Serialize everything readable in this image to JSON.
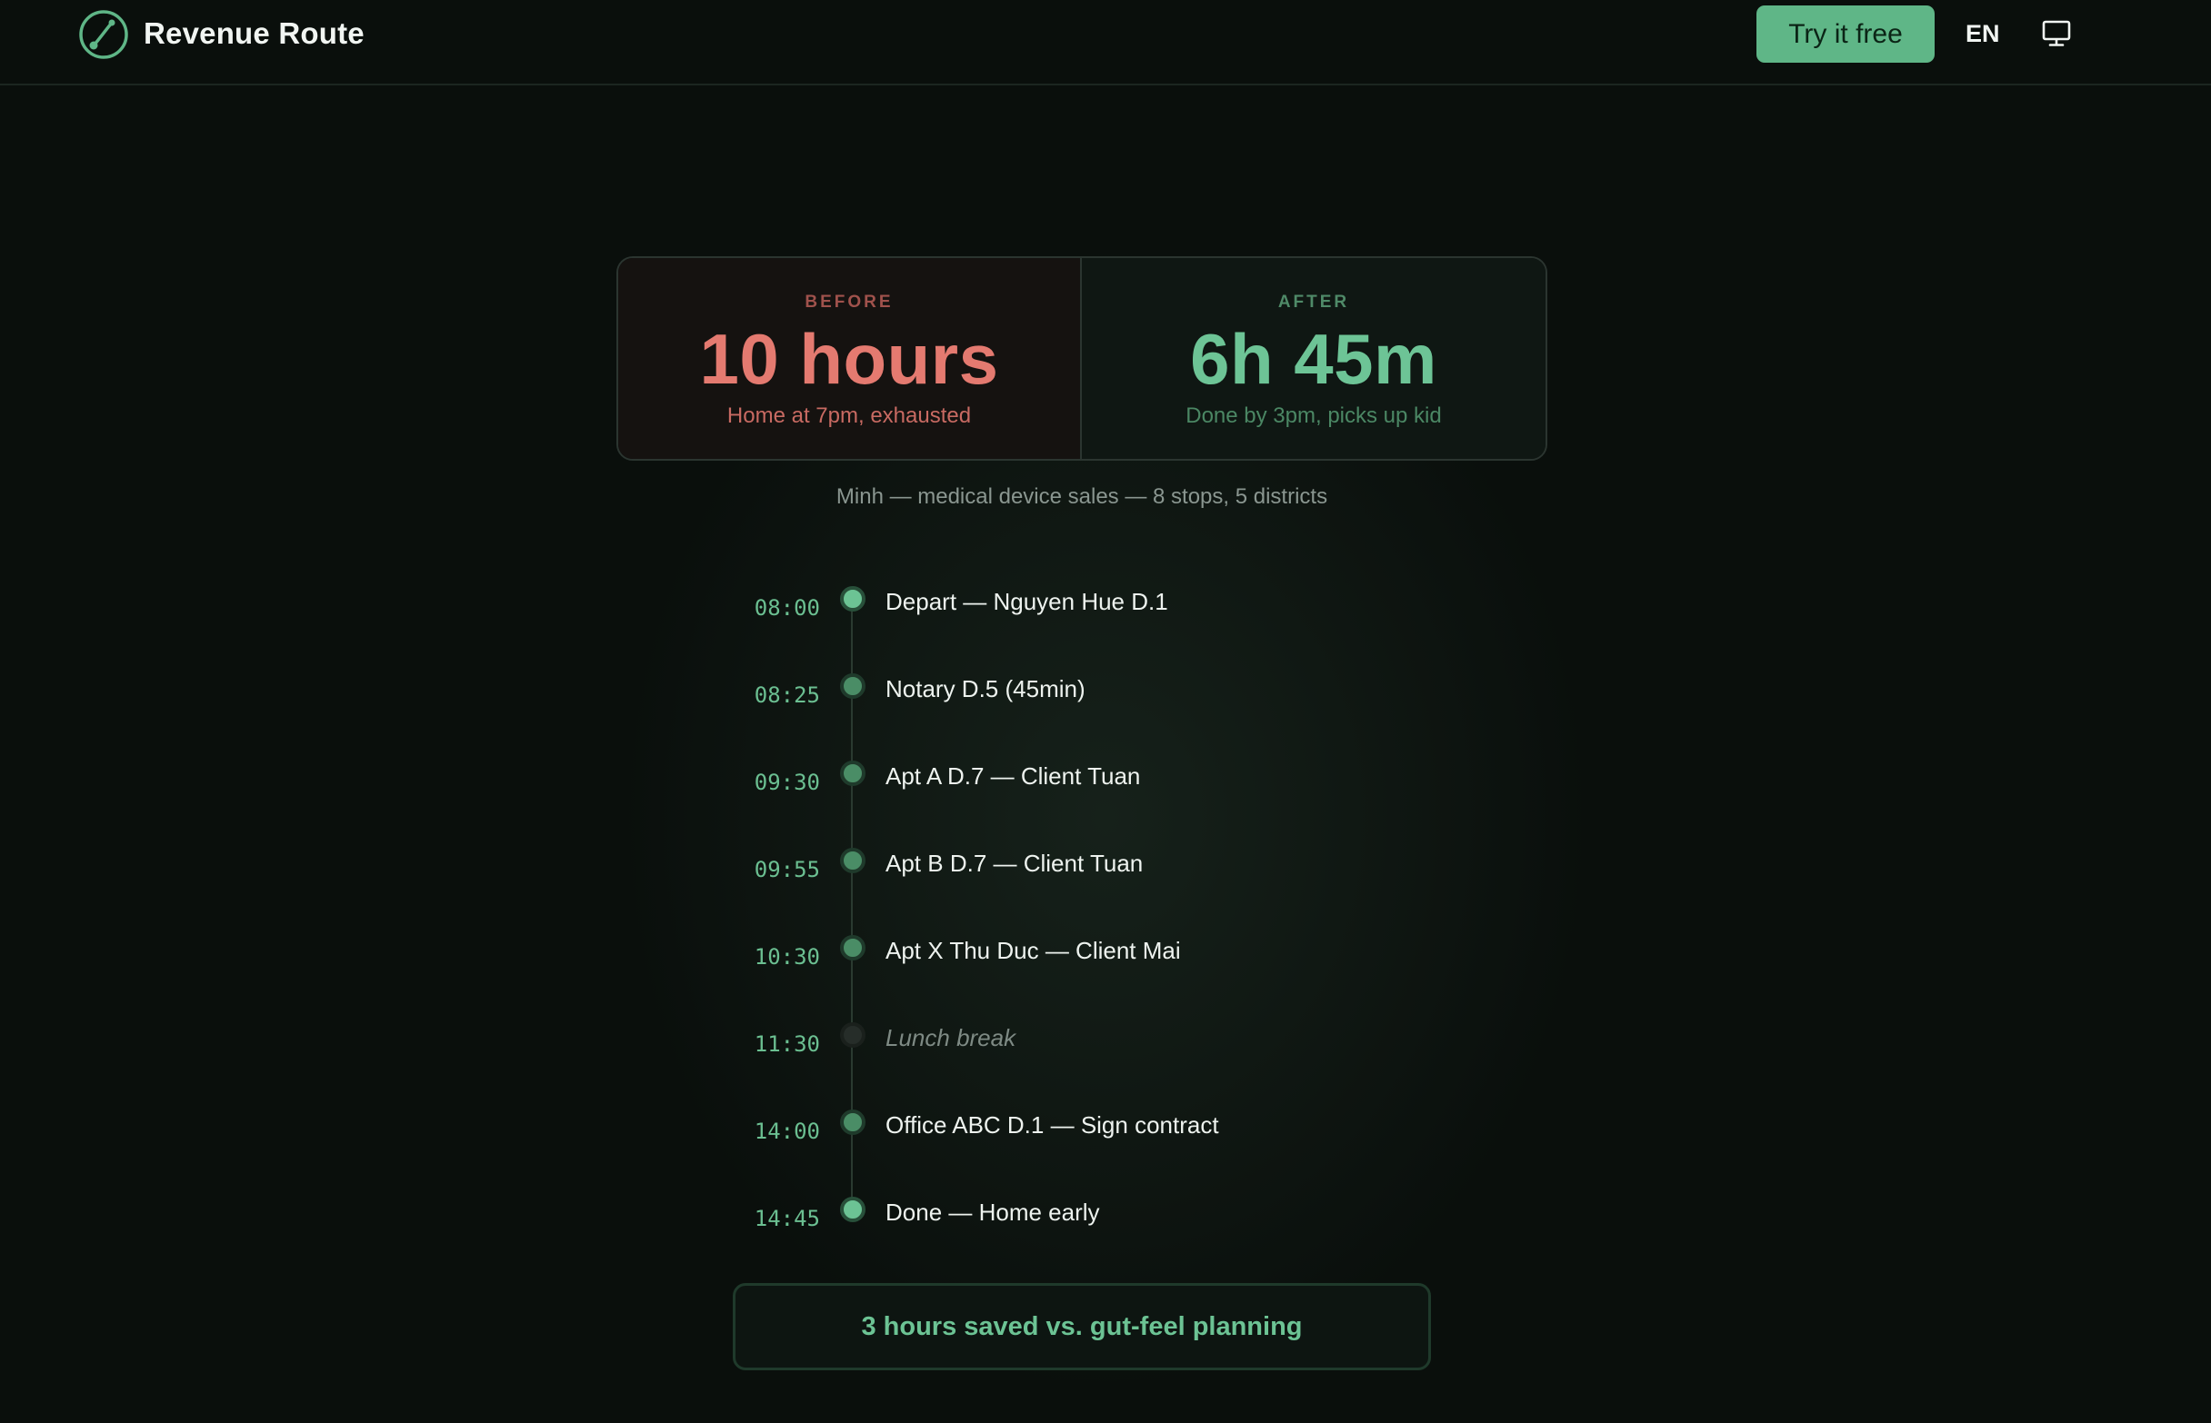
{
  "header": {
    "brand": "Revenue Route",
    "cta_label": "Try it free",
    "language": "EN",
    "icons": {
      "logo": "route-logo-icon",
      "display": "monitor-icon"
    }
  },
  "comparison": {
    "before": {
      "label": "BEFORE",
      "value": "10 hours",
      "sub": "Home at 7pm, exhausted"
    },
    "after": {
      "label": "AFTER",
      "value": "6h 45m",
      "sub": "Done by 3pm, picks up kid"
    }
  },
  "caption": "Minh — medical device sales — 8 stops, 5 districts",
  "timeline": [
    {
      "time": "08:00",
      "label": "Depart — Nguyen Hue D.1"
    },
    {
      "time": "08:25",
      "label": "Notary D.5 (45min)"
    },
    {
      "time": "09:30",
      "label": "Apt A D.7 — Client Tuan"
    },
    {
      "time": "09:55",
      "label": "Apt B D.7 — Client Tuan"
    },
    {
      "time": "10:30",
      "label": "Apt X Thu Duc — Client Mai"
    },
    {
      "time": "11:30",
      "label": "Lunch break"
    },
    {
      "time": "14:00",
      "label": "Office ABC D.1 — Sign contract"
    },
    {
      "time": "14:45",
      "label": "Done — Home early"
    }
  ],
  "summary": "3 hours saved vs. gut-feel planning",
  "colors": {
    "accent": "#5fb687",
    "before": "#e47a70",
    "after": "#6dc496",
    "background": "#0a0f0c"
  }
}
